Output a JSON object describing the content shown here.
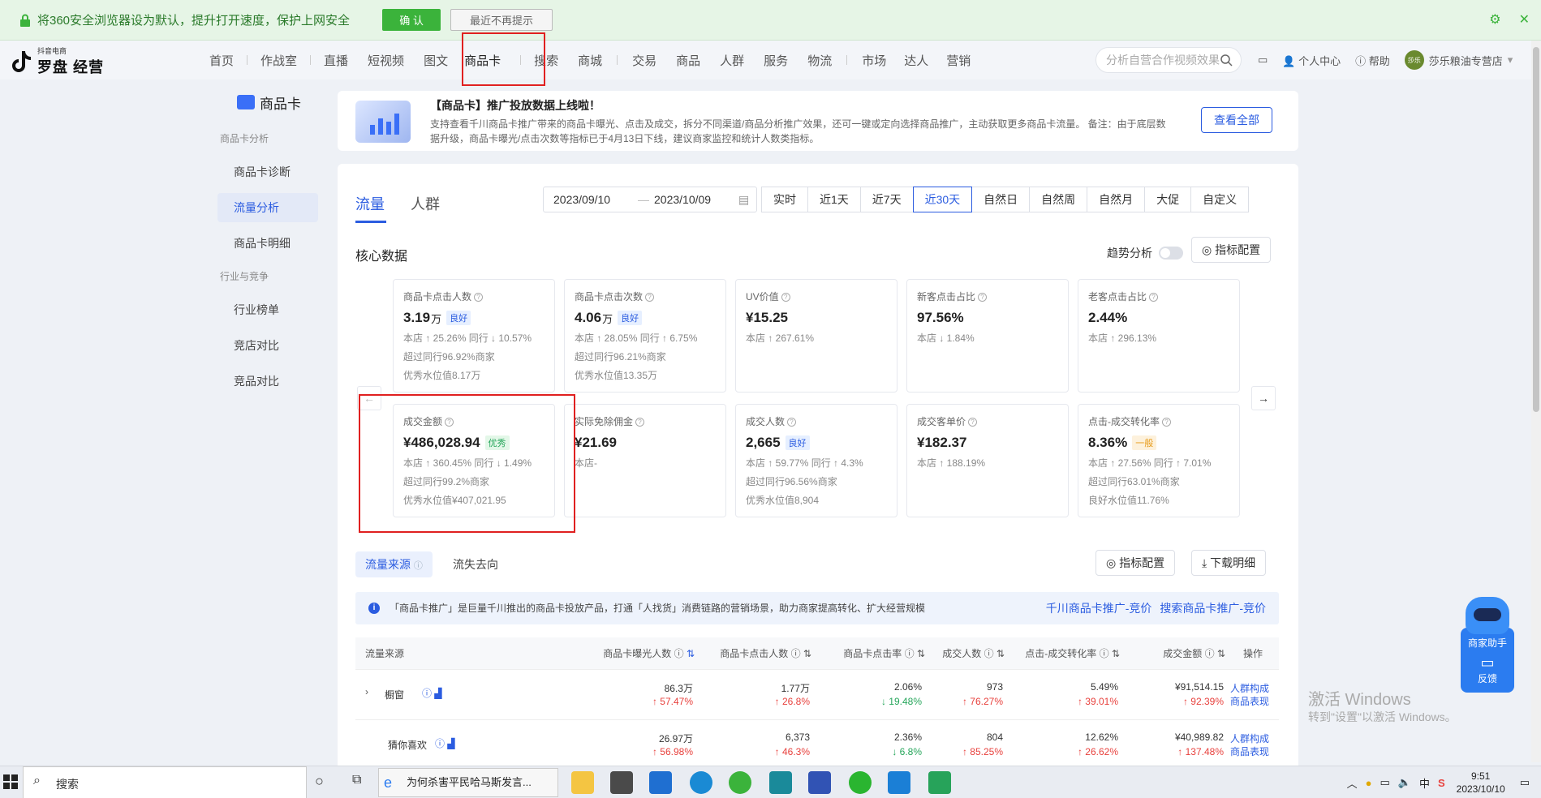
{
  "notice": {
    "text": "将360安全浏览器设为默认，提升打开速度，保护上网安全",
    "ok": "确 认",
    "dismiss": "最近不再提示"
  },
  "logo": {
    "small": "抖音电商",
    "big": "罗盘 经营"
  },
  "topnav": {
    "items": [
      "首页",
      "作战室",
      "直播",
      "短视频",
      "图文",
      "商品卡",
      "搜索",
      "商城",
      "交易",
      "商品",
      "人群",
      "服务",
      "物流",
      "市场",
      "达人",
      "营销"
    ],
    "search_placeholder": "分析自营合作视频效果",
    "user_center": "个人中心",
    "help": "帮助",
    "avatar_text": "莎乐",
    "shop_name": "莎乐粮油专营店"
  },
  "sidebar": {
    "title": "商品卡",
    "group1": "商品卡分析",
    "items1": [
      "商品卡诊断",
      "流量分析",
      "商品卡明细"
    ],
    "group2": "行业与竞争",
    "items2": [
      "行业榜单",
      "竞店对比",
      "竞品对比"
    ]
  },
  "banner": {
    "title": "【商品卡】推广投放数据上线啦！",
    "desc": "支持查看千川商品卡推广带来的商品卡曝光、点击及成交，拆分不同渠道/商品分析推广效果，还可一键或定向选择商品推广，主动获取更多商品卡流量。 备注：由于底层数据升级，商品卡曝光/点击次数等指标已于4月13日下线，建议商家监控和统计人数类指标。",
    "button": "查看全部"
  },
  "main": {
    "tabs": [
      "流量",
      "人群"
    ],
    "date_start": "2023/09/10",
    "date_sep": "—",
    "date_end": "2023/10/09",
    "ranges": [
      "实时",
      "近1天",
      "近7天",
      "近30天",
      "自然日",
      "自然周",
      "自然月",
      "大促",
      "自定义"
    ],
    "core_title": "核心数据",
    "trend_label": "趋势分析",
    "metric_config": "指标配置"
  },
  "metrics": [
    {
      "label": "商品卡点击人数",
      "value": "3.19",
      "unit": "万",
      "badge": "良好",
      "badge_type": "good",
      "lines": [
        "本店 ↑ 25.26%  同行 ↓ 10.57%",
        "超过同行96.92%商家",
        "优秀水位值8.17万"
      ]
    },
    {
      "label": "商品卡点击次数",
      "value": "4.06",
      "unit": "万",
      "badge": "良好",
      "badge_type": "good",
      "lines": [
        "本店 ↑ 28.05%  同行 ↑ 6.75%",
        "超过同行96.21%商家",
        "优秀水位值13.35万"
      ]
    },
    {
      "label": "UV价值",
      "value": "¥15.25",
      "unit": "",
      "badge": "",
      "badge_type": "",
      "lines": [
        "本店 ↑ 267.61%"
      ]
    },
    {
      "label": "新客点击占比",
      "value": "97.56%",
      "unit": "",
      "badge": "",
      "badge_type": "",
      "lines": [
        "本店 ↓ 1.84%"
      ]
    },
    {
      "label": "老客点击占比",
      "value": "2.44%",
      "unit": "",
      "badge": "",
      "badge_type": "",
      "lines": [
        "本店 ↑ 296.13%"
      ]
    },
    {
      "label": "成交金额",
      "value": "¥486,028.94",
      "unit": "",
      "badge": "优秀",
      "badge_type": "ex",
      "lines": [
        "本店 ↑ 360.45%  同行 ↓ 1.49%",
        "超过同行99.2%商家",
        "优秀水位值¥407,021.95"
      ]
    },
    {
      "label": "实际免除佣金",
      "value": "¥21.69",
      "unit": "",
      "badge": "",
      "badge_type": "",
      "lines": [
        "本店-"
      ]
    },
    {
      "label": "成交人数",
      "value": "2,665",
      "unit": "",
      "badge": "良好",
      "badge_type": "good",
      "lines": [
        "本店 ↑ 59.77%  同行 ↑ 4.3%",
        "超过同行96.56%商家",
        "优秀水位值8,904"
      ]
    },
    {
      "label": "成交客单价",
      "value": "¥182.37",
      "unit": "",
      "badge": "",
      "badge_type": "",
      "lines": [
        "本店 ↑ 188.19%"
      ]
    },
    {
      "label": "点击-成交转化率",
      "value": "8.36%",
      "unit": "",
      "badge": "一般",
      "badge_type": "mid",
      "lines": [
        "本店 ↑ 27.56%  同行 ↑ 7.01%",
        "超过同行63.01%商家",
        "良好水位值11.76%"
      ]
    }
  ],
  "flow": {
    "tab_source": "流量来源",
    "tab_loss": "流失去向",
    "config": "指标配置",
    "download": "下载明细",
    "info": "「商品卡推广」是巨量千川推出的商品卡投放产品，打通「人找货」消费链路的营销场景，助力商家提高转化、扩大经营规模",
    "link1": "千川商品卡推广-竞价",
    "link2": "搜索商品卡推广-竞价",
    "headers": [
      "流量来源",
      "商品卡曝光人数",
      "商品卡点击人数",
      "商品卡点击率",
      "成交人数",
      "点击-成交转化率",
      "成交金额",
      "操作"
    ],
    "rows": [
      {
        "name": "橱窗",
        "c1": "86.3",
        "c1u": "万",
        "c1d": "↑ 57.47%",
        "c2": "1.77",
        "c2u": "万",
        "c2d": "↑ 26.8%",
        "c3": "2.06%",
        "c3d": "↓ 19.48%",
        "c4": "973",
        "c4d": "↑ 76.27%",
        "c5": "5.49%",
        "c5d": "↑ 39.01%",
        "c6": "¥91,514.15",
        "c6d": "↑ 92.39%",
        "op1": "人群构成",
        "op2": "商品表现"
      },
      {
        "name": "猜你喜欢",
        "c1": "26.97",
        "c1u": "万",
        "c1d": "↑ 56.98%",
        "c2": "6,373",
        "c2u": "",
        "c2d": "↑ 46.3%",
        "c3": "2.36%",
        "c3d": "↓ 6.8%",
        "c4": "804",
        "c4d": "↑ 85.25%",
        "c5": "12.62%",
        "c5d": "↑ 26.62%",
        "c6": "¥40,989.82",
        "c6d": "↑ 137.48%",
        "op1": "人群构成",
        "op2": "商品表现"
      }
    ]
  },
  "helper": {
    "top": "商家助手",
    "bottom": "反馈"
  },
  "watermark": {
    "line1": "激活 Windows",
    "line2": "转到\"设置\"以激活 Windows。"
  },
  "taskbar": {
    "search": "搜索",
    "browser_tab": "为何杀害平民哈马斯发言...",
    "ime": "中",
    "time": "9:51",
    "date": "2023/10/10"
  },
  "colors": {
    "accent": "#2b5ce0",
    "up": "#e8413d",
    "down": "#26a65b",
    "highlight": "#e02020"
  }
}
